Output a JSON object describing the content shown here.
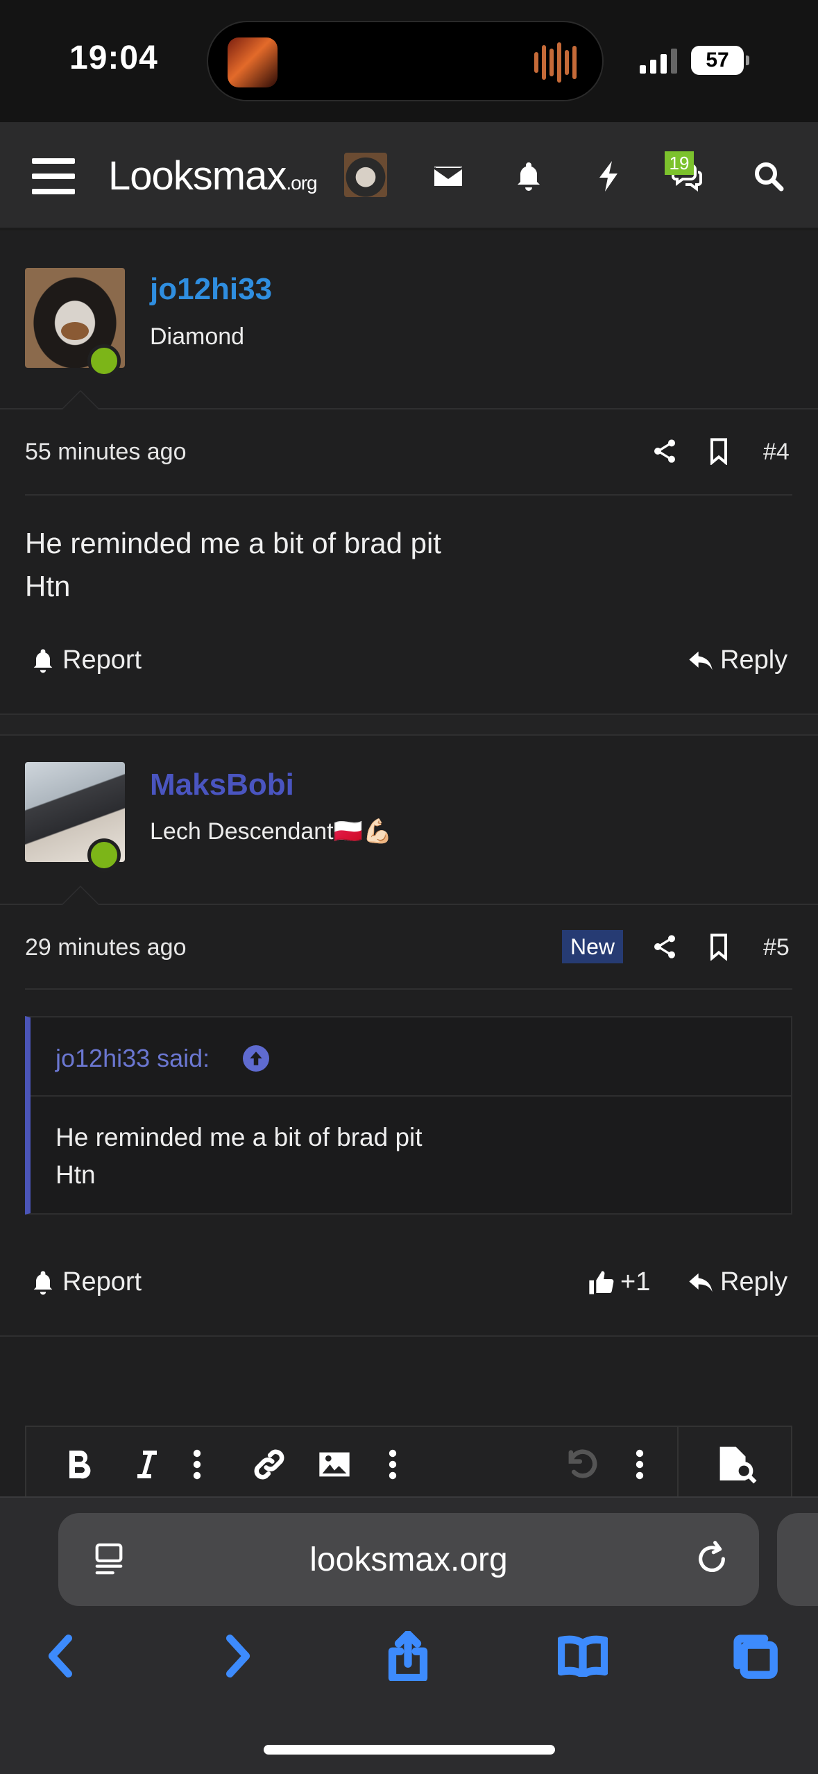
{
  "status_bar": {
    "time": "19:04",
    "battery": "57"
  },
  "header": {
    "logo_main": "Looksmax",
    "logo_suffix": ".org",
    "chat_badge": "19",
    "icons": [
      "menu-icon",
      "mail-icon",
      "bell-icon",
      "lightning-icon",
      "chat-icon",
      "search-icon"
    ]
  },
  "posts": [
    {
      "username": "jo12hi33",
      "username_color": "#2f8ee0",
      "user_title": "Diamond",
      "time": "55 minutes ago",
      "post_number": "#4",
      "body_lines": [
        "He reminded me a bit of brad pit",
        "Htn"
      ],
      "report_label": "Report",
      "reply_label": "Reply"
    },
    {
      "username": "MaksBobi",
      "username_color": "#4a55c0",
      "user_title": "Lech Descendant🇵🇱💪🏻",
      "time": "29 minutes ago",
      "new_badge": "New",
      "post_number": "#5",
      "quote": {
        "attribution": "jo12hi33 said:",
        "lines": [
          "He reminded me a bit of brad pit",
          "Htn"
        ]
      },
      "report_label": "Report",
      "like_count": "+1",
      "reply_label": "Reply"
    }
  ],
  "editor": {
    "tools": [
      "bold-icon",
      "italic-icon",
      "more-icon",
      "link-icon",
      "image-icon",
      "more-icon",
      "undo-icon",
      "more-icon",
      "preview-icon"
    ]
  },
  "browser": {
    "url": "looksmax.org"
  }
}
